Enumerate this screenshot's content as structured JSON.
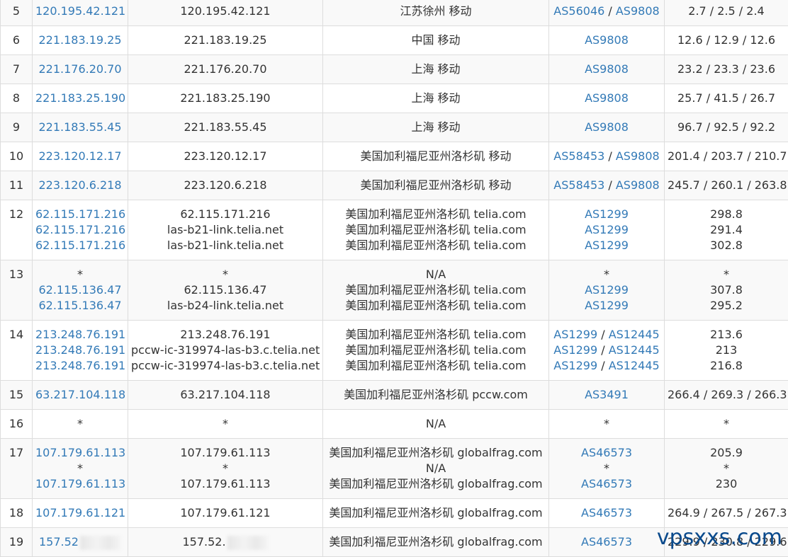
{
  "rows": [
    {
      "hop": "5",
      "ip": [
        "120.195.42.121"
      ],
      "host": [
        "120.195.42.121"
      ],
      "loc": [
        "江苏徐州 移动"
      ],
      "as": [
        [
          "AS56046",
          "AS9808"
        ]
      ],
      "rtt": [
        "2.7 / 2.5 / 2.4"
      ]
    },
    {
      "hop": "6",
      "ip": [
        "221.183.19.25"
      ],
      "host": [
        "221.183.19.25"
      ],
      "loc": [
        "中国 移动"
      ],
      "as": [
        [
          "AS9808"
        ]
      ],
      "rtt": [
        "12.6 / 12.9 / 12.6"
      ]
    },
    {
      "hop": "7",
      "ip": [
        "221.176.20.70"
      ],
      "host": [
        "221.176.20.70"
      ],
      "loc": [
        "上海 移动"
      ],
      "as": [
        [
          "AS9808"
        ]
      ],
      "rtt": [
        "23.2 / 23.3 / 23.6"
      ]
    },
    {
      "hop": "8",
      "ip": [
        "221.183.25.190"
      ],
      "host": [
        "221.183.25.190"
      ],
      "loc": [
        "上海 移动"
      ],
      "as": [
        [
          "AS9808"
        ]
      ],
      "rtt": [
        "25.7 / 41.5 / 26.7"
      ]
    },
    {
      "hop": "9",
      "ip": [
        "221.183.55.45"
      ],
      "host": [
        "221.183.55.45"
      ],
      "loc": [
        "上海 移动"
      ],
      "as": [
        [
          "AS9808"
        ]
      ],
      "rtt": [
        "96.7 / 92.5 / 92.2"
      ]
    },
    {
      "hop": "10",
      "ip": [
        "223.120.12.17"
      ],
      "host": [
        "223.120.12.17"
      ],
      "loc": [
        "美国加利福尼亚州洛杉矶 移动"
      ],
      "as": [
        [
          "AS58453",
          "AS9808"
        ]
      ],
      "rtt": [
        "201.4 / 203.7 / 210.7"
      ]
    },
    {
      "hop": "11",
      "ip": [
        "223.120.6.218"
      ],
      "host": [
        "223.120.6.218"
      ],
      "loc": [
        "美国加利福尼亚州洛杉矶 移动"
      ],
      "as": [
        [
          "AS58453",
          "AS9808"
        ]
      ],
      "rtt": [
        "245.7 / 260.1 / 263.8"
      ]
    },
    {
      "hop": "12",
      "ip": [
        "62.115.171.216",
        "62.115.171.216",
        "62.115.171.216"
      ],
      "host": [
        "62.115.171.216",
        "las-b21-link.telia.net",
        "las-b21-link.telia.net"
      ],
      "loc": [
        "美国加利福尼亚州洛杉矶 telia.com",
        "美国加利福尼亚州洛杉矶 telia.com",
        "美国加利福尼亚州洛杉矶 telia.com"
      ],
      "as": [
        [
          "AS1299"
        ],
        [
          "AS1299"
        ],
        [
          "AS1299"
        ]
      ],
      "rtt": [
        "298.8",
        "291.4",
        "302.8"
      ]
    },
    {
      "hop": "13",
      "ip": [
        "*",
        "62.115.136.47",
        "62.115.136.47"
      ],
      "host": [
        "*",
        "62.115.136.47",
        "las-b24-link.telia.net"
      ],
      "loc": [
        "N/A",
        "美国加利福尼亚州洛杉矶 telia.com",
        "美国加利福尼亚州洛杉矶 telia.com"
      ],
      "as": [
        [
          "*"
        ],
        [
          "AS1299"
        ],
        [
          "AS1299"
        ]
      ],
      "rtt": [
        "*",
        "307.8",
        "295.2"
      ]
    },
    {
      "hop": "14",
      "ip": [
        "213.248.76.191",
        "213.248.76.191",
        "213.248.76.191"
      ],
      "host": [
        "213.248.76.191",
        "pccw-ic-319974-las-b3.c.telia.net",
        "pccw-ic-319974-las-b3.c.telia.net"
      ],
      "loc": [
        "美国加利福尼亚州洛杉矶 telia.com",
        "美国加利福尼亚州洛杉矶 telia.com",
        "美国加利福尼亚州洛杉矶 telia.com"
      ],
      "as": [
        [
          "AS1299",
          "AS12445"
        ],
        [
          "AS1299",
          "AS12445"
        ],
        [
          "AS1299",
          "AS12445"
        ]
      ],
      "rtt": [
        "213.6",
        "213",
        "216.8"
      ]
    },
    {
      "hop": "15",
      "ip": [
        "63.217.104.118"
      ],
      "host": [
        "63.217.104.118"
      ],
      "loc": [
        "美国加利福尼亚州洛杉矶 pccw.com"
      ],
      "as": [
        [
          "AS3491"
        ]
      ],
      "rtt": [
        "266.4 / 269.3 / 266.3"
      ]
    },
    {
      "hop": "16",
      "ip": [
        "*"
      ],
      "host": [
        "*"
      ],
      "loc": [
        "N/A"
      ],
      "as": [
        [
          "*"
        ]
      ],
      "rtt": [
        "*"
      ]
    },
    {
      "hop": "17",
      "ip": [
        "107.179.61.113",
        "*",
        "107.179.61.113"
      ],
      "host": [
        "107.179.61.113",
        "*",
        "107.179.61.113"
      ],
      "loc": [
        "美国加利福尼亚州洛杉矶 globalfrag.com",
        "N/A",
        "美国加利福尼亚州洛杉矶 globalfrag.com"
      ],
      "as": [
        [
          "AS46573"
        ],
        [
          "*"
        ],
        [
          "AS46573"
        ]
      ],
      "rtt": [
        "205.9",
        "*",
        "230"
      ]
    },
    {
      "hop": "18",
      "ip": [
        "107.179.61.121"
      ],
      "host": [
        "107.179.61.121"
      ],
      "loc": [
        "美国加利福尼亚州洛杉矶 globalfrag.com"
      ],
      "as": [
        [
          "AS46573"
        ]
      ],
      "rtt": [
        "264.9 / 267.5 / 267.3"
      ]
    },
    {
      "hop": "19",
      "ip": [
        "157.52"
      ],
      "host": [
        "157.52."
      ],
      "loc": [
        "美国加利福尼亚州洛杉矶 globalfrag.com"
      ],
      "as": [
        [
          "AS46573"
        ]
      ],
      "rtt": [
        "229.9 / 230.8 / 229.6"
      ],
      "redacted": true
    }
  ],
  "watermark": "vpsxxs.com",
  "colors": {
    "link": "#337ab7",
    "text": "#333333",
    "border": "#dddddd",
    "stripe": "#f9f9f9",
    "watermark": "#0a4a8c"
  }
}
